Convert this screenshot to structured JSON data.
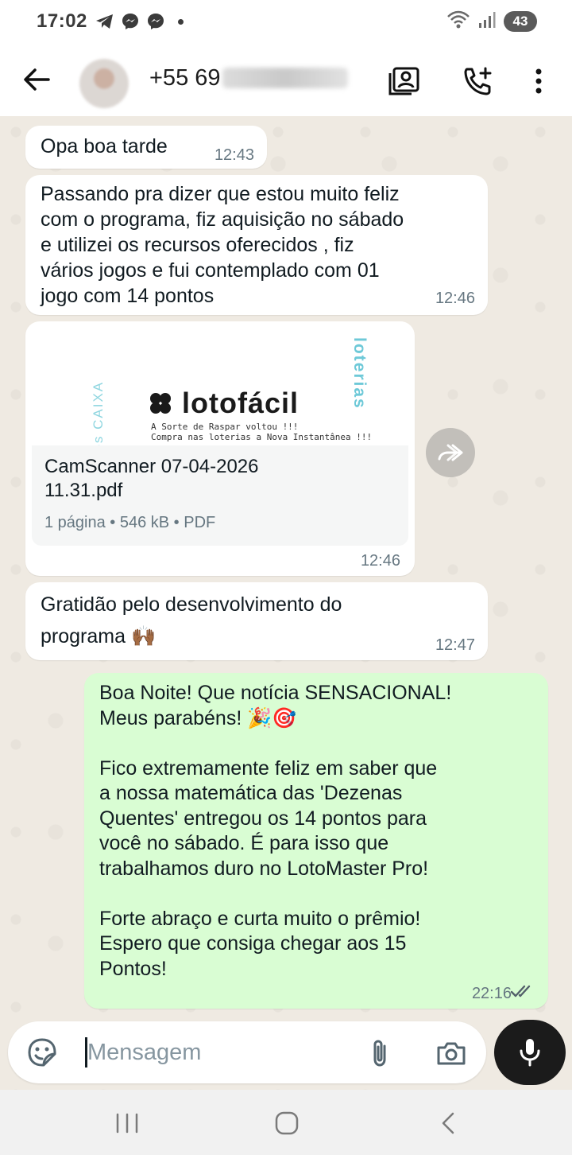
{
  "status_bar": {
    "time": "17:02",
    "battery": "43"
  },
  "header": {
    "contact_name": "+55 69"
  },
  "messages": [
    {
      "text": "Opa boa tarde",
      "time": "12:43"
    },
    {
      "text": "Passando pra dizer que estou muito feliz\ncom o programa, fiz aquisição no sábado\ne utilizei os recursos oferecidos , fiz\nvários jogos e fui contemplado com 01\njogo com 14 pontos",
      "time": "12:46"
    },
    {
      "type": "document",
      "preview": {
        "logo_text": "lotofácil",
        "side_left": "rios CAIXA",
        "side_right": "loterias",
        "small_line1": "A Sorte de Raspar voltou !!!",
        "small_line2": "Compra nas loterias a Nova Instantânea !!!"
      },
      "file_name": "CamScanner 07-04-2026\n11.31.pdf",
      "meta": "1 página • 546 kB • PDF",
      "time": "12:46"
    },
    {
      "text": "Gratidão pelo desenvolvimento do\nprograma 🙌🏾",
      "time": "12:47"
    },
    {
      "text": "Boa Noite! Que notícia SENSACIONAL!\nMeus parabéns! 🎉🎯\n\nFico extremamente feliz em saber que\na nossa matemática das 'Dezenas\nQuentes' entregou os 14 pontos para\nvocê no sábado. É para isso que\ntrabalhamos duro no LotoMaster Pro!\n\nForte abraço e curta muito o prêmio!\nEspero que consiga chegar aos 15\nPontos!",
      "time": "22:16",
      "outgoing": true
    }
  ],
  "input": {
    "placeholder": "Mensagem"
  },
  "colors": {
    "chat_bg": "#efeae2",
    "incoming_bubble": "#ffffff",
    "outgoing_bubble": "#d9fdd3",
    "read_ticks": "#53606a",
    "mic_button": "#1b1b1b"
  },
  "icons": [
    "back-arrow-icon",
    "telegram-icon",
    "messenger-icon",
    "wifi-icon",
    "signal-icon",
    "contact-card-icon",
    "add-call-icon",
    "more-vert-icon",
    "forward-icon",
    "sticker-icon",
    "paperclip-icon",
    "camera-icon",
    "mic-icon",
    "recents-icon",
    "home-icon",
    "nav-back-icon",
    "double-check-icon"
  ]
}
